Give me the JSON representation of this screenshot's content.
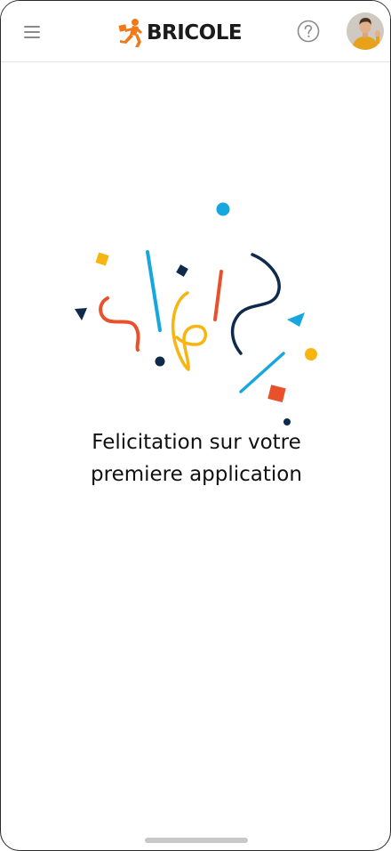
{
  "header": {
    "logo_text": "BRICOLE",
    "menu_icon": "hamburger-menu-icon",
    "help_icon": "question-circle-icon",
    "avatar_icon": "user-avatar"
  },
  "main": {
    "message_line1": "Felicitation sur votre",
    "message_line2": "premiere application",
    "illustration_icon": "confetti-illustration"
  },
  "colors": {
    "brand_orange": "#F07A1A",
    "confetti_blue": "#16A7DE",
    "confetti_navy": "#0F2A4A",
    "confetti_red": "#E8512C",
    "confetti_yellow": "#F6B511"
  }
}
